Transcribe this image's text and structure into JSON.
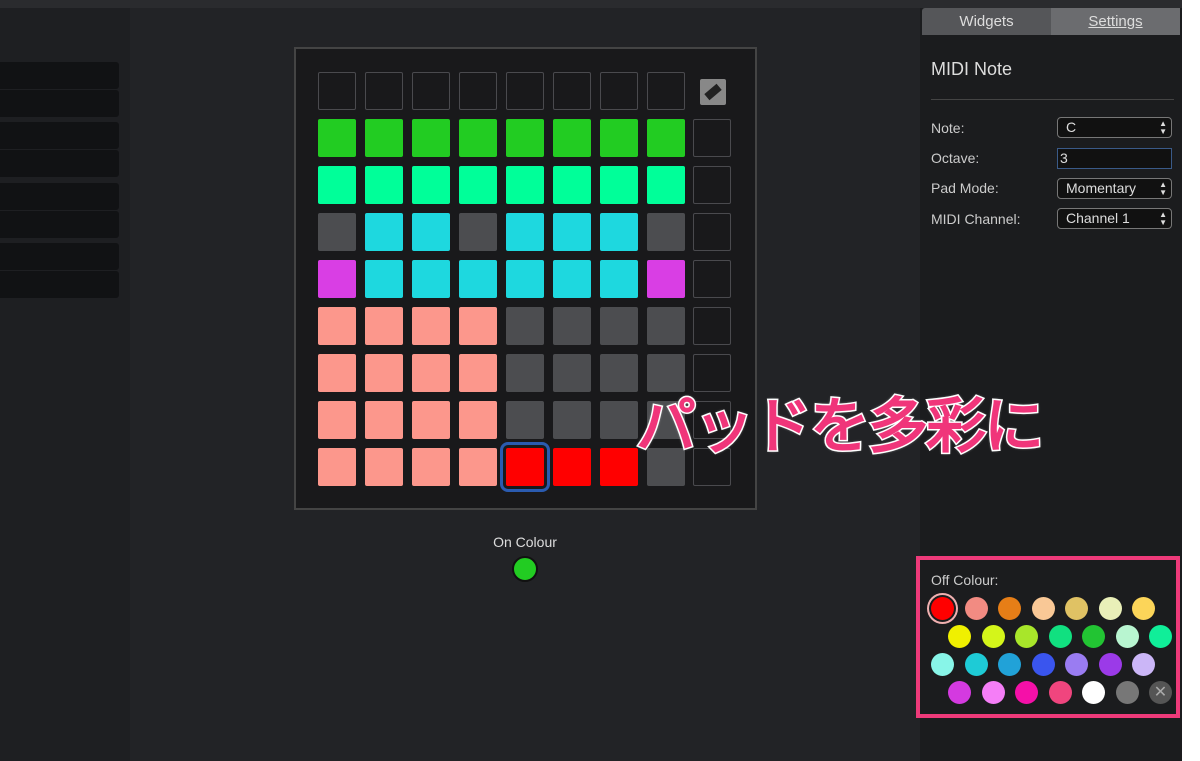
{
  "tabs": [
    {
      "label": "Widgets"
    },
    {
      "label": "Settings"
    }
  ],
  "panel": {
    "title": "MIDI Note",
    "fields": [
      {
        "label": "Note:",
        "value": "C",
        "type": "select"
      },
      {
        "label": "Octave:",
        "value": "3",
        "type": "input"
      },
      {
        "label": "Pad Mode:",
        "value": "Momentary",
        "type": "select"
      },
      {
        "label": "MIDI Channel:",
        "value": "Channel 1",
        "type": "select"
      }
    ]
  },
  "on_colour": {
    "label": "On Colour",
    "color": "#22cc22"
  },
  "off_colour": {
    "label": "Off Colour:",
    "selected": "#ff0000",
    "swatches": [
      [
        "#ff0000",
        "#f28b82",
        "#e67e17",
        "#f9c896",
        "#e0c264",
        "#e9efb8",
        "#fcd559"
      ],
      [
        "#f0f000",
        "#d4f51a",
        "#a8e62a",
        "#11e080",
        "#22c433",
        "#b8f5d0",
        "#10ee99"
      ],
      [
        "#88f5e8",
        "#1ecbd6",
        "#21a2d8",
        "#3a55ee",
        "#9a7cf2",
        "#9b3ae8",
        "#cbb6f7"
      ],
      [
        "#d43ae0",
        "#f57ef7",
        "#f510a8",
        "#f0457e",
        "#ffffff",
        "#777777",
        "none"
      ]
    ]
  },
  "pad_grid": [
    [
      "empty",
      "empty",
      "empty",
      "empty",
      "empty",
      "empty",
      "empty",
      "empty"
    ],
    [
      "#22cc22",
      "#22cc22",
      "#22cc22",
      "#22cc22",
      "#22cc22",
      "#22cc22",
      "#22cc22",
      "#22cc22"
    ],
    [
      "#00ff99",
      "#00ff99",
      "#00ff99",
      "#00ff99",
      "#00ff99",
      "#00ff99",
      "#00ff99",
      "#00ff99"
    ],
    [
      "#4c4d50",
      "#1ed8df",
      "#1ed8df",
      "#4c4d50",
      "#1ed8df",
      "#1ed8df",
      "#1ed8df",
      "#4c4d50"
    ],
    [
      "#d93ee4",
      "#1ed8df",
      "#1ed8df",
      "#1ed8df",
      "#1ed8df",
      "#1ed8df",
      "#1ed8df",
      "#d93ee4"
    ],
    [
      "#fc978c",
      "#fc978c",
      "#fc978c",
      "#fc978c",
      "#4c4d50",
      "#4c4d50",
      "#4c4d50",
      "#4c4d50"
    ],
    [
      "#fc978c",
      "#fc978c",
      "#fc978c",
      "#fc978c",
      "#4c4d50",
      "#4c4d50",
      "#4c4d50",
      "#4c4d50"
    ],
    [
      "#fc978c",
      "#fc978c",
      "#fc978c",
      "#fc978c",
      "#4c4d50",
      "#4c4d50",
      "#4c4d50",
      "#4c4d50"
    ],
    [
      "#fc978c",
      "#fc978c",
      "#fc978c",
      "#fc978c",
      "#ff0000",
      "#ff0000",
      "#ff0000",
      "#4c4d50"
    ]
  ],
  "selected_pad": {
    "row": 8,
    "col": 4
  },
  "annotation": "パッドを多彩に",
  "accent": "#ee3a7a"
}
